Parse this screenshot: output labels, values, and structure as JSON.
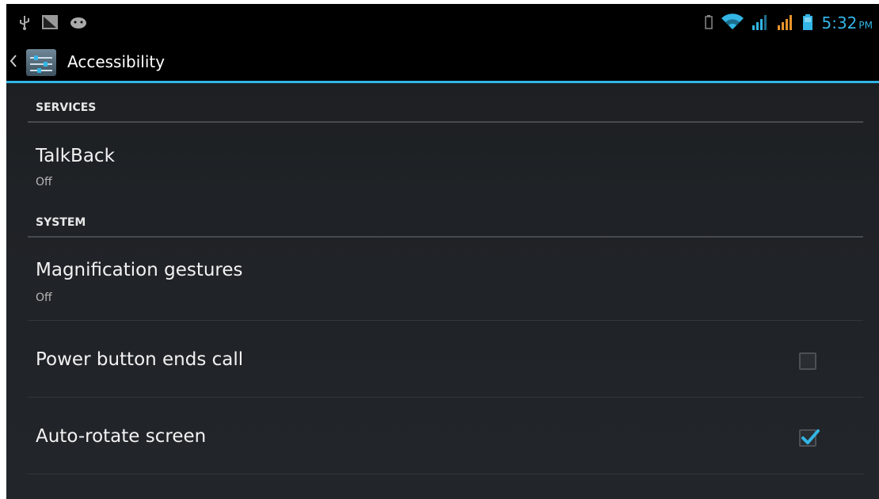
{
  "status_bar": {
    "left_icons": [
      "usb-icon",
      "screenshot-icon",
      "android-debug-icon"
    ],
    "right_icons": [
      "battery-small-icon",
      "wifi-icon",
      "signal-1-icon",
      "signal-2-icon",
      "battery-icon"
    ],
    "time": "5:32",
    "ampm": "PM"
  },
  "action_bar": {
    "title": "Accessibility"
  },
  "sections": [
    {
      "header": "SERVICES",
      "items": [
        {
          "title": "TalkBack",
          "summary": "Off"
        }
      ]
    },
    {
      "header": "SYSTEM",
      "items": [
        {
          "title": "Magnification gestures",
          "summary": "Off"
        },
        {
          "title": "Power button ends call",
          "checked": false
        },
        {
          "title": "Auto-rotate screen",
          "checked": true
        }
      ]
    }
  ],
  "colors": {
    "accent": "#33b5e5",
    "background": "#1f2226",
    "text_primary": "#f2f2f2",
    "text_secondary": "#b8b8b8"
  }
}
